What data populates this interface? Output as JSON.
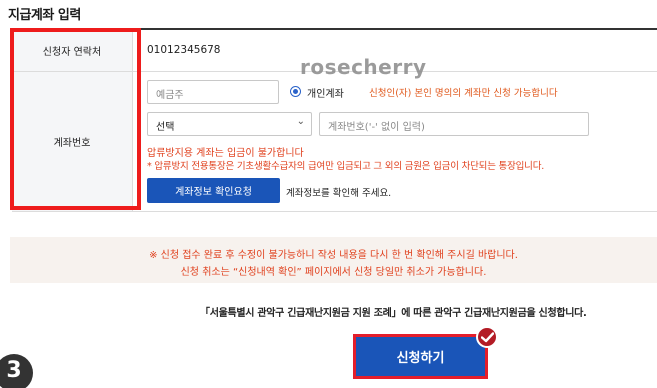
{
  "section": {
    "title": "지급계좌 입력"
  },
  "form": {
    "phone_label": "신청자 연락처",
    "phone_value": "01012345678",
    "account_label": "계좌번호",
    "holder_placeholder": "예금주",
    "radio_label": "개인계좌",
    "radio_note": "신청인(자) 본인 명의의 계좌만 신청 가능합니다",
    "bank_select": "선택",
    "account_placeholder": "계좌번호('-' 없이 입력)",
    "warning1": "압류방지용 계좌는 입금이 불가합니다",
    "warning2": "* 압류방지 전용통장은 기초생활수급자의 급여만 입금되고 그 외의 금원은 입금이 차단되는 통장입니다.",
    "confirm_button": "계좌정보 확인요청",
    "confirm_help": "계좌정보를 확인해 주세요."
  },
  "watermark": "rosecherry",
  "notice": {
    "line1": "※ 신청 접수 완료 후 수정이 불가능하니 작성 내용을 다시 한 번 확인해 주시길 바랍니다.",
    "line2": "신청 취소는 “신청내역 확인” 페이지에서 신청 당일만 취소가 가능합니다."
  },
  "agreement": "「서울특별시 관악구 긴급재난지원금 지원 조례」에 따른 관악구 긴급재난지원금을 신청합니다.",
  "apply_button": "신청하기",
  "step_number": "3",
  "icons": {
    "check": "check-icon",
    "select": "chevron-down-icon"
  },
  "colors": {
    "primary": "#1a55b8",
    "warning": "#e0411e",
    "highlight": "#ee1c1c"
  }
}
